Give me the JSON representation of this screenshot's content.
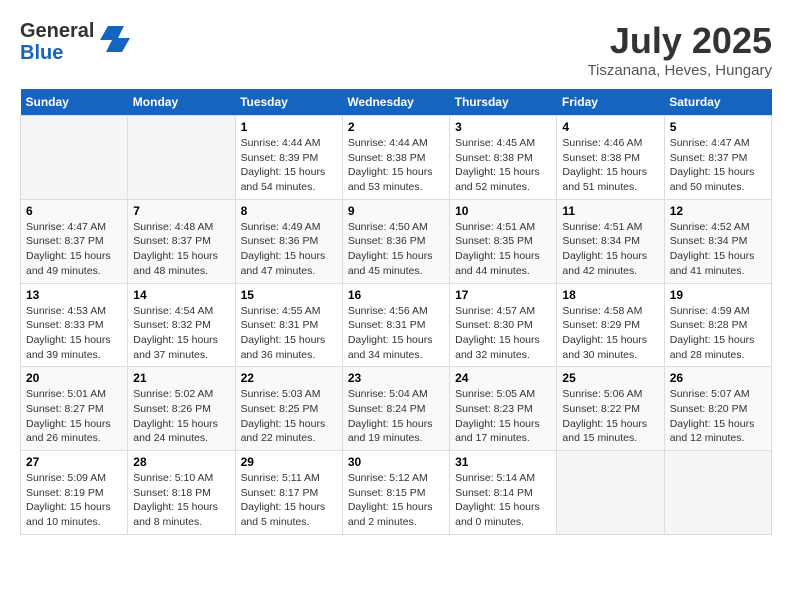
{
  "header": {
    "logo_line1": "General",
    "logo_line2": "Blue",
    "month": "July 2025",
    "location": "Tiszanana, Heves, Hungary"
  },
  "weekdays": [
    "Sunday",
    "Monday",
    "Tuesday",
    "Wednesday",
    "Thursday",
    "Friday",
    "Saturday"
  ],
  "weeks": [
    [
      {
        "day": "",
        "empty": true
      },
      {
        "day": "",
        "empty": true
      },
      {
        "day": "1",
        "sunrise": "Sunrise: 4:44 AM",
        "sunset": "Sunset: 8:39 PM",
        "daylight": "Daylight: 15 hours and 54 minutes."
      },
      {
        "day": "2",
        "sunrise": "Sunrise: 4:44 AM",
        "sunset": "Sunset: 8:38 PM",
        "daylight": "Daylight: 15 hours and 53 minutes."
      },
      {
        "day": "3",
        "sunrise": "Sunrise: 4:45 AM",
        "sunset": "Sunset: 8:38 PM",
        "daylight": "Daylight: 15 hours and 52 minutes."
      },
      {
        "day": "4",
        "sunrise": "Sunrise: 4:46 AM",
        "sunset": "Sunset: 8:38 PM",
        "daylight": "Daylight: 15 hours and 51 minutes."
      },
      {
        "day": "5",
        "sunrise": "Sunrise: 4:47 AM",
        "sunset": "Sunset: 8:37 PM",
        "daylight": "Daylight: 15 hours and 50 minutes."
      }
    ],
    [
      {
        "day": "6",
        "sunrise": "Sunrise: 4:47 AM",
        "sunset": "Sunset: 8:37 PM",
        "daylight": "Daylight: 15 hours and 49 minutes."
      },
      {
        "day": "7",
        "sunrise": "Sunrise: 4:48 AM",
        "sunset": "Sunset: 8:37 PM",
        "daylight": "Daylight: 15 hours and 48 minutes."
      },
      {
        "day": "8",
        "sunrise": "Sunrise: 4:49 AM",
        "sunset": "Sunset: 8:36 PM",
        "daylight": "Daylight: 15 hours and 47 minutes."
      },
      {
        "day": "9",
        "sunrise": "Sunrise: 4:50 AM",
        "sunset": "Sunset: 8:36 PM",
        "daylight": "Daylight: 15 hours and 45 minutes."
      },
      {
        "day": "10",
        "sunrise": "Sunrise: 4:51 AM",
        "sunset": "Sunset: 8:35 PM",
        "daylight": "Daylight: 15 hours and 44 minutes."
      },
      {
        "day": "11",
        "sunrise": "Sunrise: 4:51 AM",
        "sunset": "Sunset: 8:34 PM",
        "daylight": "Daylight: 15 hours and 42 minutes."
      },
      {
        "day": "12",
        "sunrise": "Sunrise: 4:52 AM",
        "sunset": "Sunset: 8:34 PM",
        "daylight": "Daylight: 15 hours and 41 minutes."
      }
    ],
    [
      {
        "day": "13",
        "sunrise": "Sunrise: 4:53 AM",
        "sunset": "Sunset: 8:33 PM",
        "daylight": "Daylight: 15 hours and 39 minutes."
      },
      {
        "day": "14",
        "sunrise": "Sunrise: 4:54 AM",
        "sunset": "Sunset: 8:32 PM",
        "daylight": "Daylight: 15 hours and 37 minutes."
      },
      {
        "day": "15",
        "sunrise": "Sunrise: 4:55 AM",
        "sunset": "Sunset: 8:31 PM",
        "daylight": "Daylight: 15 hours and 36 minutes."
      },
      {
        "day": "16",
        "sunrise": "Sunrise: 4:56 AM",
        "sunset": "Sunset: 8:31 PM",
        "daylight": "Daylight: 15 hours and 34 minutes."
      },
      {
        "day": "17",
        "sunrise": "Sunrise: 4:57 AM",
        "sunset": "Sunset: 8:30 PM",
        "daylight": "Daylight: 15 hours and 32 minutes."
      },
      {
        "day": "18",
        "sunrise": "Sunrise: 4:58 AM",
        "sunset": "Sunset: 8:29 PM",
        "daylight": "Daylight: 15 hours and 30 minutes."
      },
      {
        "day": "19",
        "sunrise": "Sunrise: 4:59 AM",
        "sunset": "Sunset: 8:28 PM",
        "daylight": "Daylight: 15 hours and 28 minutes."
      }
    ],
    [
      {
        "day": "20",
        "sunrise": "Sunrise: 5:01 AM",
        "sunset": "Sunset: 8:27 PM",
        "daylight": "Daylight: 15 hours and 26 minutes."
      },
      {
        "day": "21",
        "sunrise": "Sunrise: 5:02 AM",
        "sunset": "Sunset: 8:26 PM",
        "daylight": "Daylight: 15 hours and 24 minutes."
      },
      {
        "day": "22",
        "sunrise": "Sunrise: 5:03 AM",
        "sunset": "Sunset: 8:25 PM",
        "daylight": "Daylight: 15 hours and 22 minutes."
      },
      {
        "day": "23",
        "sunrise": "Sunrise: 5:04 AM",
        "sunset": "Sunset: 8:24 PM",
        "daylight": "Daylight: 15 hours and 19 minutes."
      },
      {
        "day": "24",
        "sunrise": "Sunrise: 5:05 AM",
        "sunset": "Sunset: 8:23 PM",
        "daylight": "Daylight: 15 hours and 17 minutes."
      },
      {
        "day": "25",
        "sunrise": "Sunrise: 5:06 AM",
        "sunset": "Sunset: 8:22 PM",
        "daylight": "Daylight: 15 hours and 15 minutes."
      },
      {
        "day": "26",
        "sunrise": "Sunrise: 5:07 AM",
        "sunset": "Sunset: 8:20 PM",
        "daylight": "Daylight: 15 hours and 12 minutes."
      }
    ],
    [
      {
        "day": "27",
        "sunrise": "Sunrise: 5:09 AM",
        "sunset": "Sunset: 8:19 PM",
        "daylight": "Daylight: 15 hours and 10 minutes."
      },
      {
        "day": "28",
        "sunrise": "Sunrise: 5:10 AM",
        "sunset": "Sunset: 8:18 PM",
        "daylight": "Daylight: 15 hours and 8 minutes."
      },
      {
        "day": "29",
        "sunrise": "Sunrise: 5:11 AM",
        "sunset": "Sunset: 8:17 PM",
        "daylight": "Daylight: 15 hours and 5 minutes."
      },
      {
        "day": "30",
        "sunrise": "Sunrise: 5:12 AM",
        "sunset": "Sunset: 8:15 PM",
        "daylight": "Daylight: 15 hours and 2 minutes."
      },
      {
        "day": "31",
        "sunrise": "Sunrise: 5:14 AM",
        "sunset": "Sunset: 8:14 PM",
        "daylight": "Daylight: 15 hours and 0 minutes."
      },
      {
        "day": "",
        "empty": true
      },
      {
        "day": "",
        "empty": true
      }
    ]
  ]
}
